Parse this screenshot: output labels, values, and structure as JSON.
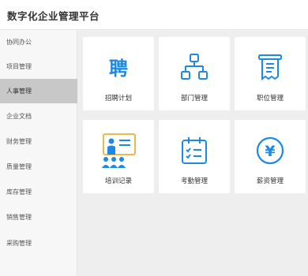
{
  "app": {
    "title": "数字化企业管理平台"
  },
  "sidebar": {
    "items": [
      {
        "label": "协同办公"
      },
      {
        "label": "项目管理"
      },
      {
        "label": "人事管理"
      },
      {
        "label": "企业文档"
      },
      {
        "label": "财务管理"
      },
      {
        "label": "质量管理"
      },
      {
        "label": "库存管理"
      },
      {
        "label": "销售管理"
      },
      {
        "label": "采购管理"
      }
    ],
    "active": "人事管理"
  },
  "cards": [
    {
      "label": "招聘计划",
      "icon": "recruit-icon",
      "glyph": "聘"
    },
    {
      "label": "部门管理",
      "icon": "org-chart-icon"
    },
    {
      "label": "职位管理",
      "icon": "position-doc-icon"
    },
    {
      "label": "培训记录",
      "icon": "training-icon"
    },
    {
      "label": "考勤管理",
      "icon": "calendar-checklist-icon"
    },
    {
      "label": "薪资管理",
      "icon": "yuan-coin-icon",
      "glyph": "¥"
    }
  ],
  "colors": {
    "accent": "#1e88e5",
    "training_accent": "#f2b84b"
  }
}
